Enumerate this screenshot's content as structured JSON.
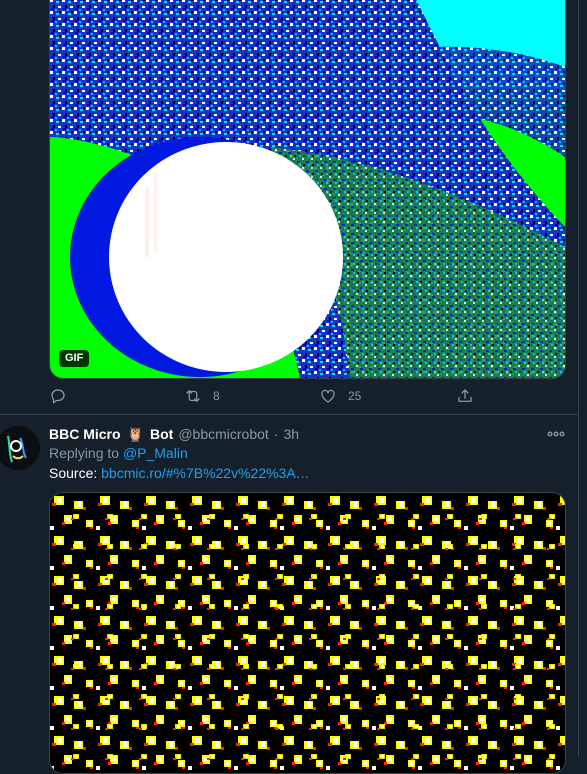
{
  "tweet1": {
    "gif_badge": "GIF",
    "actions": {
      "reply_count": "",
      "retweet_count": "8",
      "like_count": "25"
    }
  },
  "tweet2": {
    "display_name": "BBC Micro",
    "name_suffix": "Bot",
    "owl_emoji": "🦉",
    "handle": "@bbcmicrobot",
    "separator": "·",
    "time": "3h",
    "replying_prefix": "Replying to",
    "replying_to": "@P_Malin",
    "source_label": "Source:",
    "source_link": "bbcmic.ro/#%7B%22v%22%3A…"
  },
  "colors": {
    "background": "#15202b",
    "border": "#38444d",
    "muted": "#8899a6",
    "link": "#1da1f2"
  }
}
